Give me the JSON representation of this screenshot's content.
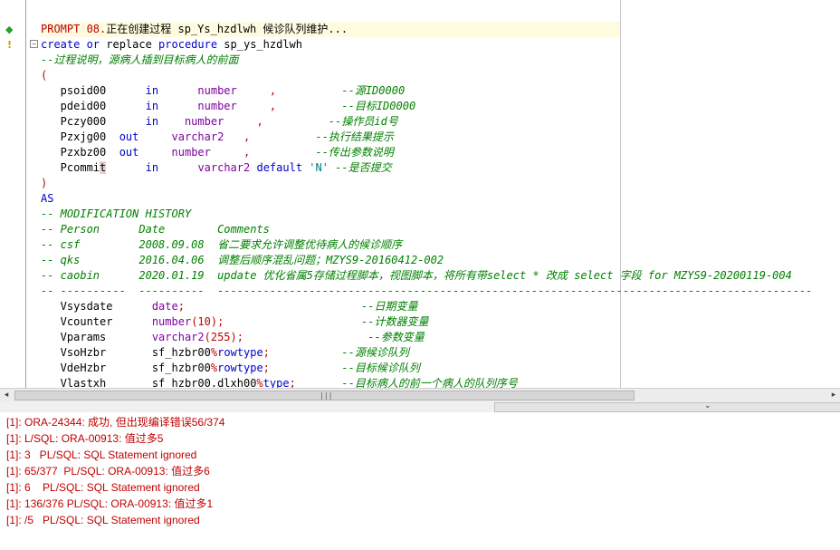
{
  "gutter": {
    "markers": [
      "◆",
      "!"
    ]
  },
  "code": [
    {
      "spans": [
        [
          "rd",
          "PROMPT 08."
        ],
        [
          "",
          "正在创建过程 sp_Ys_hzdlwh 候诊队列维护..."
        ]
      ],
      "hl": true
    },
    {
      "spans": [
        [
          "kw",
          "create or "
        ],
        [
          "",
          "replace "
        ],
        [
          "kw",
          "procedure "
        ],
        [
          "",
          "sp_ys_hzdlwh"
        ]
      ]
    },
    {
      "spans": [
        [
          "cm",
          "--过程说明，源病人插到目标病人的前面"
        ]
      ]
    },
    {
      "spans": [
        [
          "rd",
          "("
        ]
      ]
    },
    {
      "spans": [
        [
          "",
          "   psoid00      "
        ],
        [
          "kw",
          "in"
        ],
        [
          "",
          "      "
        ],
        [
          "ty",
          "number"
        ],
        [
          "",
          "     "
        ],
        [
          "rd",
          ","
        ],
        [
          "",
          "          "
        ],
        [
          "cm",
          "--源ID0000"
        ]
      ]
    },
    {
      "spans": [
        [
          "",
          "   pdeid00      "
        ],
        [
          "kw",
          "in"
        ],
        [
          "",
          "      "
        ],
        [
          "ty",
          "number"
        ],
        [
          "",
          "     "
        ],
        [
          "rd",
          ","
        ],
        [
          "",
          "          "
        ],
        [
          "cm",
          "--目标ID0000"
        ]
      ]
    },
    {
      "spans": [
        [
          "",
          "   Pczy000      "
        ],
        [
          "kw",
          "in"
        ],
        [
          "",
          "    "
        ],
        [
          "ty",
          "number"
        ],
        [
          "",
          "     "
        ],
        [
          "rd",
          ","
        ],
        [
          "",
          "          "
        ],
        [
          "cm",
          "--操作员id号"
        ]
      ]
    },
    {
      "spans": [
        [
          "",
          "   Pzxjg00  "
        ],
        [
          "kw",
          "out"
        ],
        [
          "",
          "     "
        ],
        [
          "ty",
          "varchar2"
        ],
        [
          "",
          "   "
        ],
        [
          "rd",
          ","
        ],
        [
          "",
          "          "
        ],
        [
          "cm",
          "--执行结果提示"
        ]
      ]
    },
    {
      "spans": [
        [
          "",
          "   Pzxbz00  "
        ],
        [
          "kw",
          "out"
        ],
        [
          "",
          "     "
        ],
        [
          "ty",
          "number"
        ],
        [
          "",
          "     "
        ],
        [
          "rd",
          ","
        ],
        [
          "",
          "          "
        ],
        [
          "cm",
          "--传出参数说明"
        ]
      ]
    },
    {
      "spans": [
        [
          "",
          "   Pcommi"
        ],
        [
          "cursor-block",
          "t"
        ],
        [
          "",
          "      "
        ],
        [
          "kw",
          "in"
        ],
        [
          "",
          "      "
        ],
        [
          "ty",
          "varchar2 "
        ],
        [
          "kw",
          "default "
        ],
        [
          "st",
          "'N'"
        ],
        [
          "",
          ""
        ],
        [
          "cm",
          " --是否提交"
        ]
      ]
    },
    {
      "spans": [
        [
          "rd",
          ")"
        ]
      ]
    },
    {
      "spans": [
        [
          "kw",
          "AS"
        ]
      ]
    },
    {
      "spans": [
        [
          "cm",
          "-- MODIFICATION HISTORY"
        ]
      ]
    },
    {
      "spans": [
        [
          "cm",
          "-- Person      Date        Comments"
        ]
      ]
    },
    {
      "spans": [
        [
          "cm",
          "-- csf         2008.09.08  省二要求允许调整优待病人的候诊顺序"
        ]
      ]
    },
    {
      "spans": [
        [
          "cm",
          "-- qks         2016.04.06  调整后顺序混乱问题；MZYS9-20160412-002"
        ]
      ]
    },
    {
      "spans": [
        [
          "cm",
          "-- caobin      2020.01.19  update 优化省属5存储过程脚本，视图脚本，将所有带select * 改成 select 字段 for MZYS9-20200119-004"
        ]
      ]
    },
    {
      "spans": [
        [
          "cm",
          "-- ----------  ----------  -------------------------------------------------------------------------------------------"
        ]
      ]
    },
    {
      "spans": [
        [
          "",
          "   Vsysdate      "
        ],
        [
          "ty",
          "date"
        ],
        [
          "rd",
          ";"
        ],
        [
          "",
          "                           "
        ],
        [
          "cm",
          "--日期变量"
        ]
      ]
    },
    {
      "spans": [
        [
          "",
          "   Vcounter      "
        ],
        [
          "ty",
          "number"
        ],
        [
          "rd",
          "(10);"
        ],
        [
          "",
          "                     "
        ],
        [
          "cm",
          "--计数器变量"
        ]
      ]
    },
    {
      "spans": [
        [
          "",
          "   Vparams       "
        ],
        [
          "ty",
          "varchar2"
        ],
        [
          "rd",
          "(255);"
        ],
        [
          "",
          "                   "
        ],
        [
          "cm",
          "--参数变量"
        ]
      ]
    },
    {
      "spans": [
        [
          "",
          "   VsoHzbr       "
        ],
        [
          "",
          "sf_hzbr00"
        ],
        [
          "rd",
          "%"
        ],
        [
          "kw",
          "rowtype"
        ],
        [
          "rd",
          ";"
        ],
        [
          "",
          "           "
        ],
        [
          "cm",
          "--源候诊队列"
        ]
      ]
    },
    {
      "spans": [
        [
          "",
          "   VdeHzbr       "
        ],
        [
          "",
          "sf_hzbr00"
        ],
        [
          "rd",
          "%"
        ],
        [
          "kw",
          "rowtype"
        ],
        [
          "rd",
          ";"
        ],
        [
          "",
          "           "
        ],
        [
          "cm",
          "--目标候诊队列"
        ]
      ]
    },
    {
      "spans": [
        [
          "",
          "   Vlastxh       "
        ],
        [
          "",
          "sf_hzbr00.dlxh00"
        ],
        [
          "rd",
          "%"
        ],
        [
          "kw",
          "type"
        ],
        [
          "rd",
          ";"
        ],
        [
          "",
          "       "
        ],
        [
          "cm",
          "--目标病人的前一个病人的队列序号"
        ]
      ]
    }
  ],
  "messages": [
    "[1]: ORA-24344: 成功, 但出现编译错误56/374",
    "[1]: L/SQL: ORA-00913: 值过多5",
    "[1]: 3   PL/SQL: SQL Statement ignored",
    "[1]: 65/377  PL/SQL: ORA-00913: 值过多6",
    "[1]: 6    PL/SQL: SQL Statement ignored",
    "[1]: 136/376 PL/SQL: ORA-00913: 值过多1",
    "[1]: /5   PL/SQL: SQL Statement ignored"
  ],
  "scroll": {
    "left_arrow": "◂",
    "right_arrow": "▸",
    "grip": "|||",
    "split_arrow": "⌄"
  }
}
